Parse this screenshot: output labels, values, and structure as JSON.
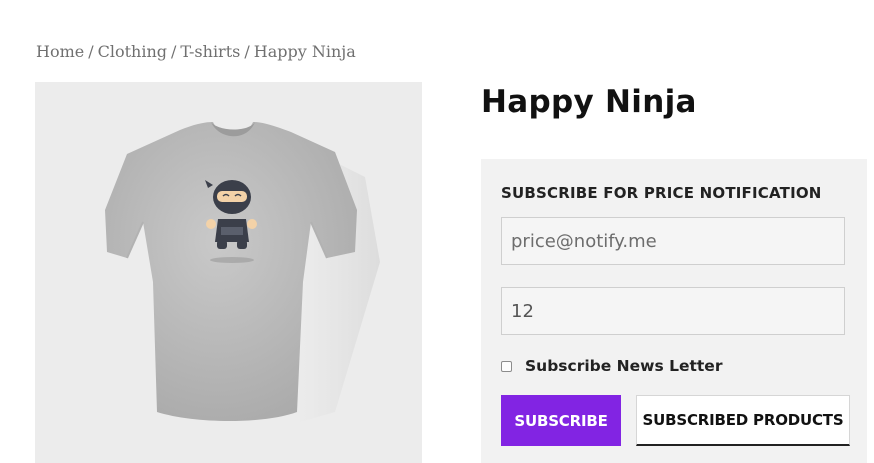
{
  "breadcrumb": {
    "items": [
      "Home",
      "Clothing",
      "T-shirts",
      "Happy Ninja"
    ],
    "separator": "/"
  },
  "product": {
    "title": "Happy Ninja",
    "image_alt_icon": "tshirt-ninja-image"
  },
  "subscribe_form": {
    "heading": "SUBSCRIBE FOR PRICE NOTIFICATION",
    "email_placeholder": "price@notify.me",
    "email_value": "",
    "price_value": "12",
    "newsletter_label": "Subscribe News Letter",
    "newsletter_checked": false,
    "subscribe_button": "SUBSCRIBE",
    "subscribed_products_button": "SUBSCRIBED PRODUCTS"
  },
  "colors": {
    "accent": "#8224e3",
    "panel_bg": "#f2f2f2",
    "image_bg": "#ececec"
  }
}
